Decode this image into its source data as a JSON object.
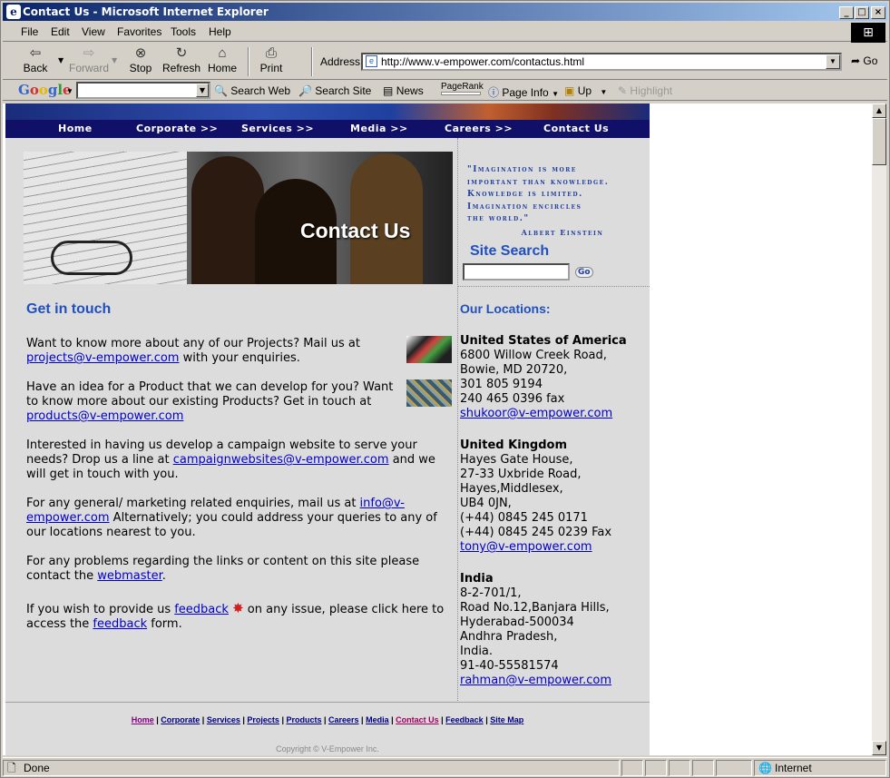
{
  "window": {
    "title": "Contact Us - Microsoft Internet Explorer"
  },
  "menu": [
    "File",
    "Edit",
    "View",
    "Favorites",
    "Tools",
    "Help"
  ],
  "toolbar": {
    "back": "Back",
    "forward": "Forward",
    "stop": "Stop",
    "refresh": "Refresh",
    "home": "Home",
    "print": "Print",
    "address_label": "Address",
    "url": "http://www.v-empower.com/contactus.html",
    "go": "Go"
  },
  "googlebar": {
    "logo": "Google",
    "search_web": "Search Web",
    "search_site": "Search Site",
    "news": "News",
    "pagerank": "PageRank",
    "page_info": "Page Info",
    "up": "Up",
    "highlight": "Highlight"
  },
  "nav": [
    "Home",
    "Corporate >>",
    "Services >>",
    "Media >>",
    "Careers >>",
    "Contact Us"
  ],
  "hero": {
    "title": "Contact Us"
  },
  "quote": {
    "lines": [
      "Imagination is more",
      "important than knowledge.",
      "Knowledge is limited.",
      "Imagination encircles",
      "the world."
    ],
    "author": "Albert Einstein"
  },
  "site_search": {
    "label": "Site Search",
    "go": "Go"
  },
  "main": {
    "heading": "Get in touch",
    "p1": {
      "text1": "Want to know more about any of our Projects? Mail us at",
      "link": "projects@v-empower.com",
      "text2": " with your enquiries."
    },
    "p2": {
      "text1": "Have an idea for a Product that we can develop for you? Want to know more about our existing Products? Get in touch at ",
      "link": "products@v-empower.com"
    },
    "p3": {
      "text1": "Interested in having us develop a campaign website to serve your needs? Drop us a line at ",
      "link": "campaignwebsites@v-empower.com",
      "text2": " and we will get in touch with you."
    },
    "p4": {
      "text1": "For any general/ marketing related enquiries, mail us at ",
      "link": "info@v-empower.com",
      "text2": " Alternatively; you could address your queries to any of our locations nearest to you."
    },
    "p5": {
      "text1": "For any problems regarding the links or content on this site please contact the ",
      "link": "webmaster",
      "text2": "."
    },
    "p6": {
      "text1": "If you wish to provide us ",
      "link1": "feedback",
      "text2": " on any issue, please click here to access the ",
      "link2": "feedback",
      "text3": " form."
    }
  },
  "locations": {
    "heading": "Our Locations:",
    "usa": {
      "name": "United States of America",
      "lines": [
        "6800 Willow Creek Road,",
        "Bowie, MD 20720,",
        "301 805 9194",
        "240 465 0396 fax"
      ],
      "email": "shukoor@v-empower.com"
    },
    "uk": {
      "name": "United Kingdom",
      "lines": [
        "Hayes Gate House,",
        "27-33 Uxbride Road,",
        "Hayes,Middlesex,",
        "UB4 0JN,",
        "(+44) 0845 245 0171",
        "(+44) 0845 245 0239 Fax"
      ],
      "email": "tony@v-empower.com"
    },
    "india": {
      "name": "India",
      "lines": [
        "8-2-701/1,",
        "Road No.12,Banjara Hills,",
        "Hyderabad-500034",
        "Andhra Pradesh,",
        "India.",
        "91-40-55581574"
      ],
      "email": "rahman@v-empower.com"
    }
  },
  "footer": {
    "links": [
      "Home",
      "Corporate",
      "Services",
      "Projects",
      "Products",
      "Careers",
      "Media",
      "Contact Us",
      "Feedback",
      "Site Map"
    ],
    "copyright": "Copyright © V-Empower Inc."
  },
  "status": {
    "text": "Done",
    "zone": "Internet"
  }
}
